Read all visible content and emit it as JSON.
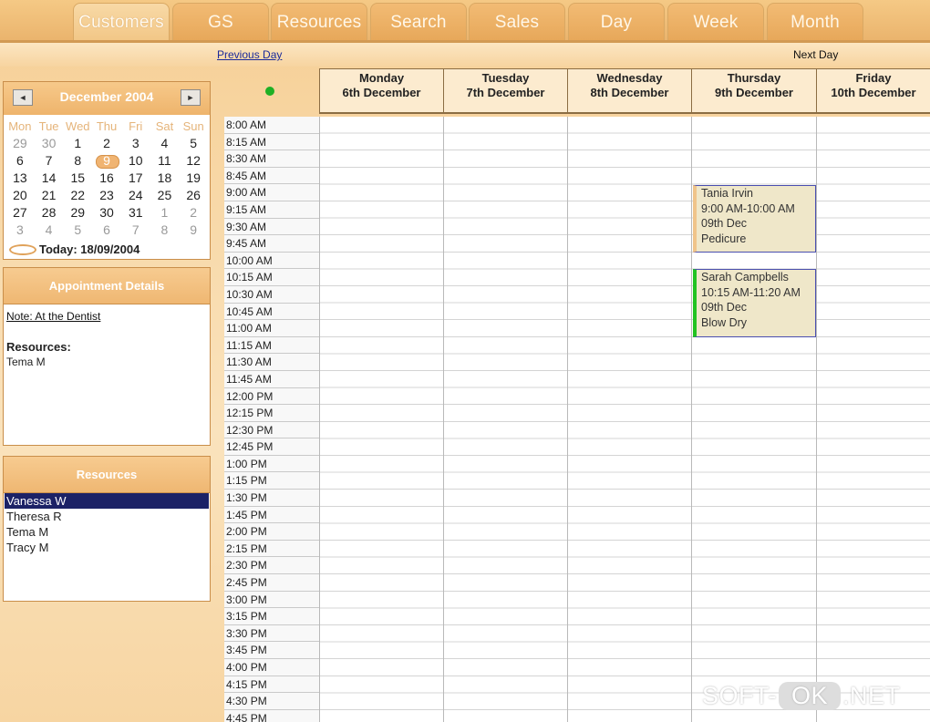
{
  "tabs": [
    {
      "label": "Customers",
      "active": true
    },
    {
      "label": "GS"
    },
    {
      "label": "Resources"
    },
    {
      "label": "Search"
    },
    {
      "label": "Sales"
    },
    {
      "label": "Day"
    },
    {
      "label": "Week"
    },
    {
      "label": "Month"
    }
  ],
  "nav": {
    "previous": "Previous Day",
    "next": "Next Day"
  },
  "calendar": {
    "month_label": "December 2004",
    "prev_icon": "◄",
    "next_icon": "►",
    "dow": [
      "Mon",
      "Tue",
      "Wed",
      "Thu",
      "Fri",
      "Sat",
      "Sun"
    ],
    "weeks": [
      [
        "29",
        "30",
        "1",
        "2",
        "3",
        "4",
        "5"
      ],
      [
        "6",
        "7",
        "8",
        "9",
        "10",
        "11",
        "12"
      ],
      [
        "13",
        "14",
        "15",
        "16",
        "17",
        "18",
        "19"
      ],
      [
        "20",
        "21",
        "22",
        "23",
        "24",
        "25",
        "26"
      ],
      [
        "27",
        "28",
        "29",
        "30",
        "31",
        "1",
        "2"
      ],
      [
        "3",
        "4",
        "5",
        "6",
        "7",
        "8",
        "9"
      ]
    ],
    "selected_day": "9",
    "today_label": "Today: 18/09/2004"
  },
  "appointment_details": {
    "title": "Appointment Details",
    "note": "Note: At the Dentist",
    "resources_label": "Resources:",
    "resources_value": "Tema M"
  },
  "resources": {
    "title": "Resources",
    "items": [
      "Vanessa W",
      "Theresa R",
      "Tema M",
      "Tracy M"
    ],
    "selected": "Vanessa W"
  },
  "days": [
    {
      "name": "Monday",
      "date": "6th December"
    },
    {
      "name": "Tuesday",
      "date": "7th December"
    },
    {
      "name": "Wednesday",
      "date": "8th December"
    },
    {
      "name": "Thursday",
      "date": "9th December"
    },
    {
      "name": "Friday",
      "date": "10th December"
    }
  ],
  "time_slots": [
    "8:00 AM",
    "8:15 AM",
    "8:30 AM",
    "8:45 AM",
    "9:00 AM",
    "9:15 AM",
    "9:30 AM",
    "9:45 AM",
    "10:00 AM",
    "10:15 AM",
    "10:30 AM",
    "10:45 AM",
    "11:00 AM",
    "11:15 AM",
    "11:30 AM",
    "11:45 AM",
    "12:00 PM",
    "12:15 PM",
    "12:30 PM",
    "12:45 PM",
    "1:00 PM",
    "1:15 PM",
    "1:30 PM",
    "1:45 PM",
    "2:00 PM",
    "2:15 PM",
    "2:30 PM",
    "2:45 PM",
    "3:00 PM",
    "3:15 PM",
    "3:30 PM",
    "3:45 PM",
    "4:00 PM",
    "4:15 PM",
    "4:30 PM",
    "4:45 PM"
  ],
  "events": [
    {
      "customer": "Tania Irvin",
      "time": "9:00 AM-10:00 AM",
      "date": "09th Dec",
      "service": "Pedicure",
      "day": "Thursday"
    },
    {
      "customer": "Sarah Campbells",
      "time": "10:15 AM-11:20 AM",
      "date": "09th Dec",
      "service": "Blow Dry",
      "day": "Thursday"
    }
  ],
  "watermark": {
    "left": "SOFT-",
    "mid": "OK",
    "right": ".NET"
  }
}
